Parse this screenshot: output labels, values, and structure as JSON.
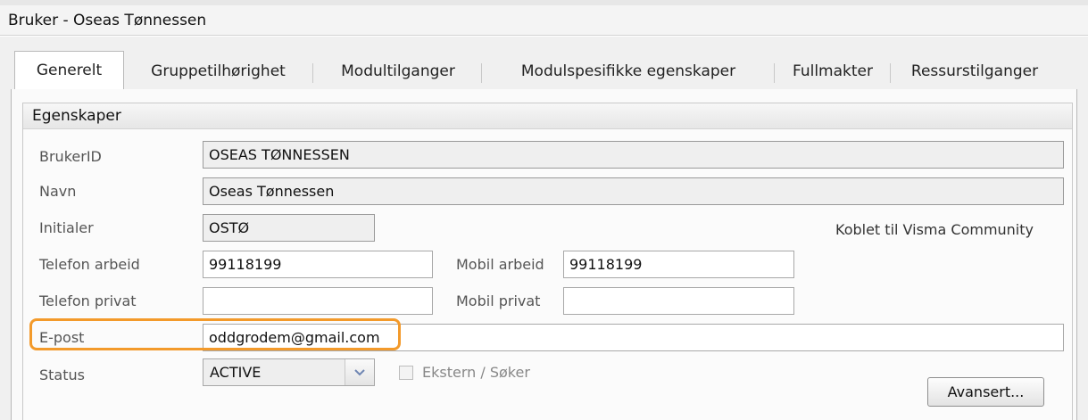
{
  "window": {
    "title": "Bruker - Oseas Tønnessen"
  },
  "tabs": [
    {
      "label": "Generelt",
      "active": true
    },
    {
      "label": "Gruppetilhørighet"
    },
    {
      "label": "Modultilganger"
    },
    {
      "label": "Modulspesifikke egenskaper"
    },
    {
      "label": "Fullmakter"
    },
    {
      "label": "Ressurstilganger"
    }
  ],
  "group": {
    "title": "Egenskaper",
    "brukerid": {
      "label": "BrukerID",
      "value": "OSEAS TØNNESSEN"
    },
    "navn": {
      "label": "Navn",
      "value": "Oseas Tønnessen"
    },
    "initialer": {
      "label": "Initialer",
      "value": "OSTØ"
    },
    "community_text": "Koblet til Visma Community",
    "telefon_arbeid": {
      "label": "Telefon arbeid",
      "value": "99118199"
    },
    "mobil_arbeid": {
      "label": "Mobil arbeid",
      "value": "99118199"
    },
    "telefon_privat": {
      "label": "Telefon privat",
      "value": ""
    },
    "mobil_privat": {
      "label": "Mobil privat",
      "value": ""
    },
    "epost": {
      "label": "E-post",
      "value": "oddgrodem@gmail.com"
    },
    "status": {
      "label": "Status",
      "value": "ACTIVE"
    },
    "ekstern": {
      "label": "Ekstern / Søker",
      "checked": false
    },
    "avansert_label": "Avansert..."
  },
  "colors": {
    "highlight": "#f39a2b",
    "panel_bg": "#fafafa",
    "readonly_bg": "#efefef"
  },
  "icons": {
    "status_dropdown": "chevron-down-icon",
    "ekstern_checkbox": "checkbox-empty-icon"
  }
}
